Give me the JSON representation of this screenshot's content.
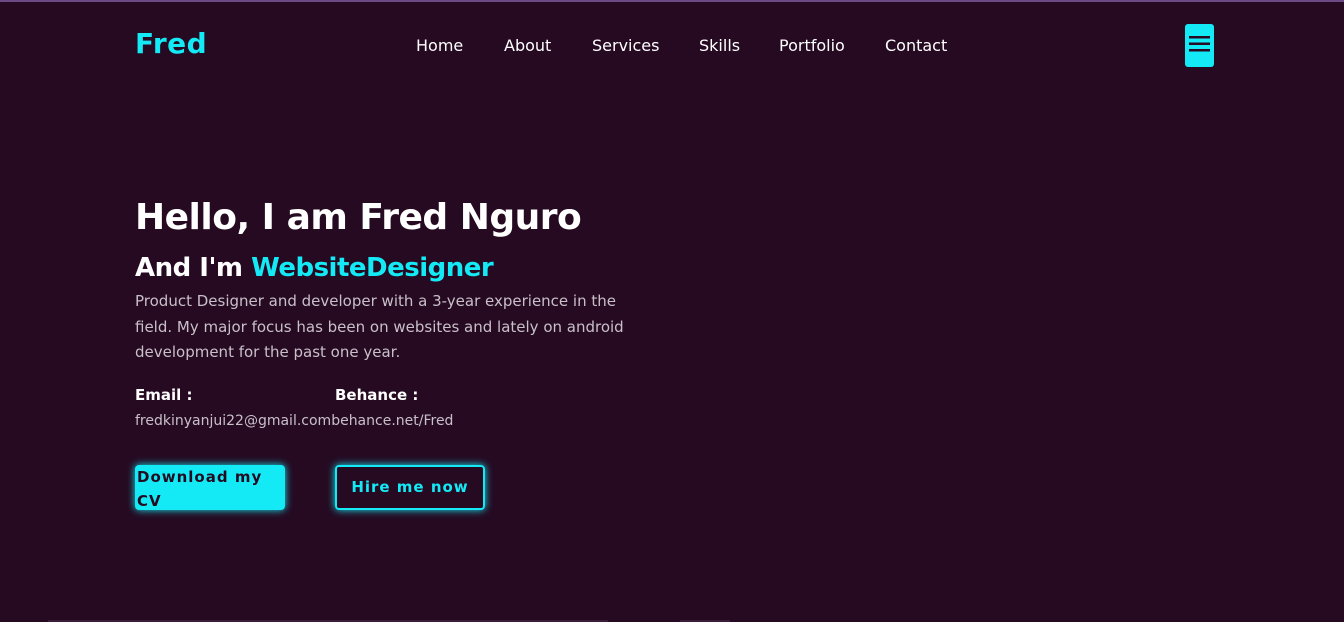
{
  "header": {
    "logo": "Fred",
    "nav": [
      "Home",
      "About",
      "Services",
      "Skills",
      "Portfolio",
      "Contact"
    ],
    "menu_icon": "hamburger-menu-icon"
  },
  "hero": {
    "title": "Hello, I am Fred Nguro",
    "subtitle_prefix": "And I'm ",
    "subtitle_role": "WebsiteDesigner",
    "description": "Product Designer and developer with a 3-year experience in the field. My major focus has been on websites and lately on android development for the past one year.",
    "email_label": "Email :",
    "email_value": "fredkinyanjui22@gmail.com",
    "behance_label": "Behance :",
    "behance_value": "behance.net/Fred",
    "download_button": "Download my CV",
    "hire_button": "Hire me now"
  },
  "colors": {
    "background": "#250a22",
    "accent": "#14eaf5",
    "text": "#ffffff",
    "muted": "#c9bfc9"
  }
}
